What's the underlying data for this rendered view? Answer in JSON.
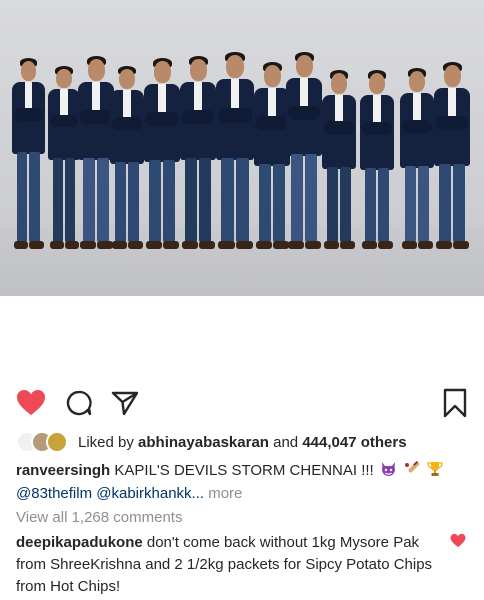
{
  "post": {
    "photo_alt_icon": "group-photo",
    "likes": {
      "prefix": "Liked by",
      "user": "abhinayabaskaran",
      "connector": "and",
      "count": "444,047 others"
    },
    "caption": {
      "username": "ranveersingh",
      "text": "KAPIL'S DEVILS STORM CHENNAI !!!",
      "emojis": [
        "devil-emoji",
        "cricket-bat-emoji",
        "trophy-emoji"
      ],
      "mention_1": "@83thefilm",
      "mention_2": "@kabirkhankk...",
      "more_label": "more"
    },
    "view_comments": "View all 1,268 comments",
    "comment": {
      "username": "deepikapadukone",
      "text": "don't come back without 1kg Mysore Pak from ShreeKrishna and 2 1/2kg packets for Sipcy Potato Chips from Hot Chips!"
    }
  },
  "colors": {
    "like_red": "#ed4956",
    "text": "#262626",
    "muted": "#8e8e8e",
    "link": "#003569",
    "jacket_navy": "#15223f"
  }
}
